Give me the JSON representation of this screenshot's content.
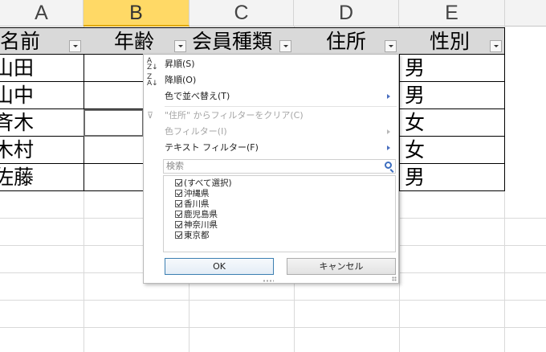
{
  "columns": [
    "A",
    "B",
    "C",
    "D",
    "E"
  ],
  "table": {
    "headers": [
      "名前",
      "年齢",
      "会員種類",
      "住所",
      "性別"
    ],
    "names": [
      "山田",
      "山中",
      "斉木",
      "木村",
      "佐藤"
    ],
    "genders": [
      "男",
      "男",
      "女",
      "女",
      "男"
    ]
  },
  "menu": {
    "sort_asc": "昇順(S)",
    "sort_desc": "降順(O)",
    "sort_by_color": "色で並べ替え(T)",
    "clear_filter": "\"住所\" からフィルターをクリア(C)",
    "color_filter": "色フィルター(I)",
    "text_filter": "テキスト フィルター(F)",
    "search_placeholder": "検索",
    "items": [
      "(すべて選択)",
      "沖縄県",
      "香川県",
      "鹿児島県",
      "神奈川県",
      "東京都"
    ],
    "ok_label": "OK",
    "cancel_label": "キャンセル"
  },
  "colors": {
    "selected_column": "#ffd966",
    "header_fill": "#d9d9d9",
    "grid": "#d9d9d9"
  }
}
